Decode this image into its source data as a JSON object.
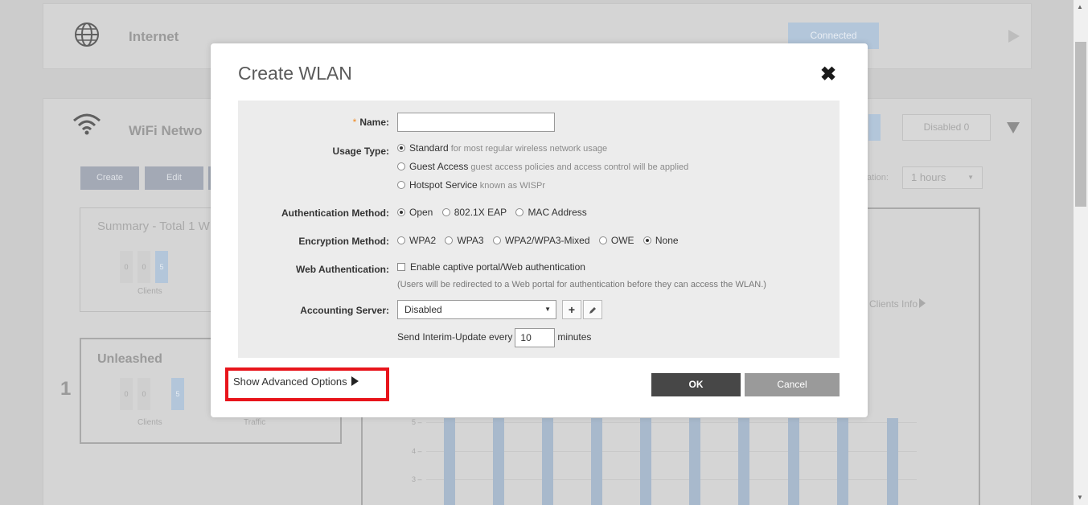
{
  "background": {
    "internet": {
      "title": "Internet",
      "status": "Connected"
    },
    "wifi": {
      "title": "WiFi Netwo",
      "disabled_badge": "Disabled  0",
      "buttons": [
        "Create",
        "Edit"
      ],
      "duration_label": "ation:",
      "duration_value": "1 hours",
      "summary_title": "Summary - Total 1 W",
      "summary_counts": [
        "0",
        "0",
        "5"
      ],
      "clients_label": "Clients",
      "clients_info": "Clients Info",
      "unleashed_title": "Unleashed",
      "unleashed_index": "1",
      "unleashed_counts": [
        "0",
        "0",
        "5"
      ],
      "traffic_label": "Traffic",
      "chart_y_ticks": [
        "5 –",
        "4 –",
        "3 –"
      ]
    }
  },
  "modal": {
    "title": "Create WLAN",
    "close_icon": "close-icon",
    "fields": {
      "name": {
        "label": "Name:",
        "required_mark": "*",
        "value": ""
      },
      "usage_type": {
        "label": "Usage Type:",
        "options": [
          {
            "label": "Standard",
            "hint": "for most regular wireless network usage",
            "selected": true
          },
          {
            "label": "Guest Access",
            "hint": "guest access policies and access control will be applied",
            "selected": false
          },
          {
            "label": "Hotspot Service",
            "hint": "known as WISPr",
            "selected": false
          }
        ]
      },
      "auth_method": {
        "label": "Authentication Method:",
        "options": [
          {
            "label": "Open",
            "selected": true
          },
          {
            "label": "802.1X EAP",
            "selected": false
          },
          {
            "label": "MAC Address",
            "selected": false
          }
        ]
      },
      "encryption_method": {
        "label": "Encryption Method:",
        "options": [
          {
            "label": "WPA2",
            "selected": false
          },
          {
            "label": "WPA3",
            "selected": false
          },
          {
            "label": "WPA2/WPA3-Mixed",
            "selected": false
          },
          {
            "label": "OWE",
            "selected": false
          },
          {
            "label": "None",
            "selected": true
          }
        ]
      },
      "web_auth": {
        "label": "Web Authentication:",
        "checkbox_label": "Enable captive portal/Web authentication",
        "checked": false,
        "note": "(Users will be redirected to a Web portal for authentication before they can access the WLAN.)"
      },
      "accounting_server": {
        "label": "Accounting Server:",
        "selected": "Disabled",
        "add_icon": "plus-icon",
        "edit_icon": "pencil-icon",
        "interim_prefix": "Send Interim-Update every",
        "interim_value": "10",
        "interim_suffix": "minutes"
      }
    },
    "advanced_link": "Show Advanced Options",
    "ok_label": "OK",
    "cancel_label": "Cancel"
  },
  "colors": {
    "highlight_box": "#e8141b",
    "required_mark": "#f08a24",
    "ok_button": "#474747",
    "cancel_button": "#9a9a9a"
  }
}
